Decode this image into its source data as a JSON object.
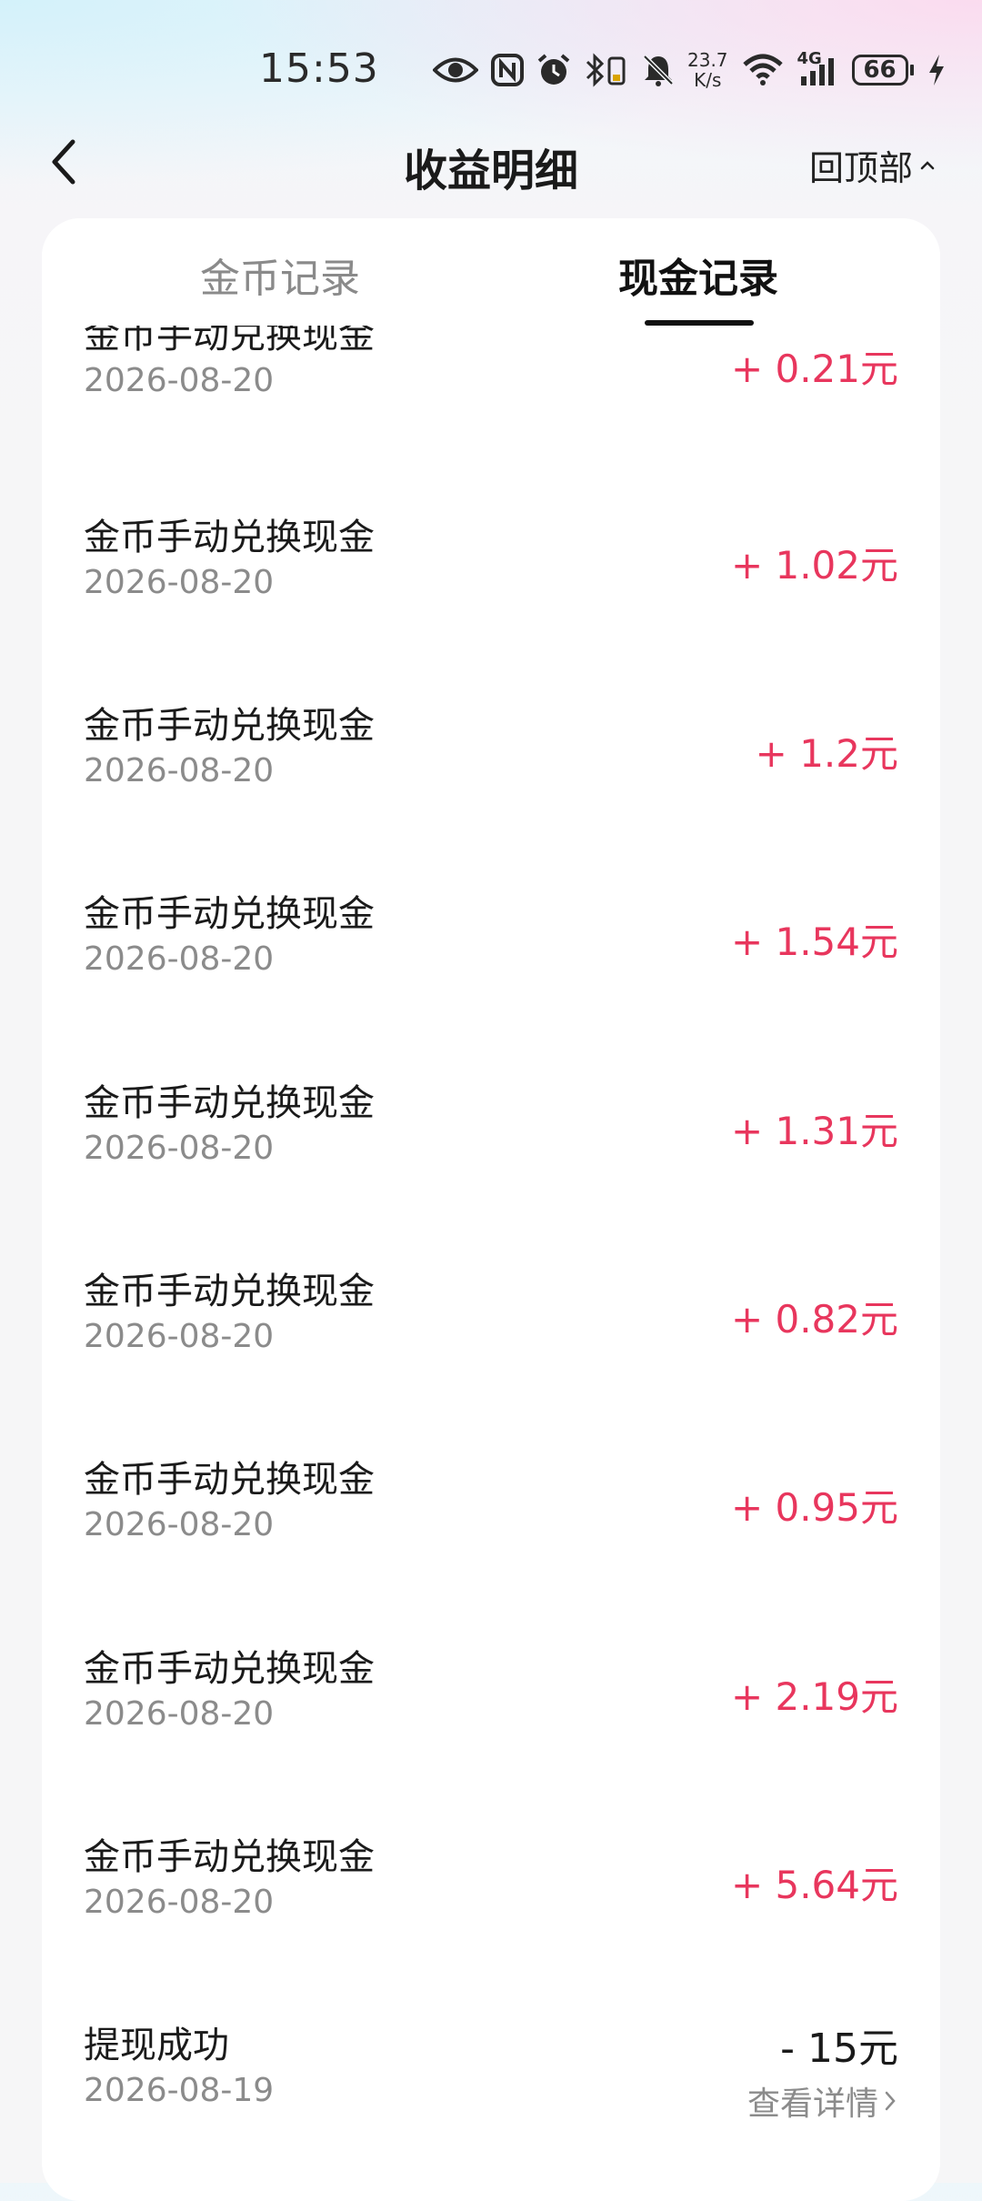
{
  "status_bar": {
    "time": "15:53",
    "net_speed_value": "23.7",
    "net_speed_unit": "K/s",
    "signal_label": "4G",
    "battery": "66",
    "icons": [
      "eye-icon",
      "nfc-icon",
      "alarm-icon",
      "bluetooth-battery-icon",
      "bell-off-icon",
      "wifi-icon",
      "cellular-signal-icon",
      "battery-icon",
      "charging-bolt-icon"
    ]
  },
  "header": {
    "title": "收益明细",
    "back_to_top": "回顶部"
  },
  "tabs": [
    {
      "label": "金币记录",
      "active": false
    },
    {
      "label": "现金记录",
      "active": true
    }
  ],
  "colors": {
    "accent_red": "#e8365d",
    "muted_gray": "#8b8b8b"
  },
  "records": [
    {
      "title": "金币手动兑换现金",
      "date": "2026-08-20",
      "amount": "+ 0.21元"
    },
    {
      "title": "金币手动兑换现金",
      "date": "2026-08-20",
      "amount": "+ 1.02元"
    },
    {
      "title": "金币手动兑换现金",
      "date": "2026-08-20",
      "amount": "+ 1.2元"
    },
    {
      "title": "金币手动兑换现金",
      "date": "2026-08-20",
      "amount": "+ 1.54元"
    },
    {
      "title": "金币手动兑换现金",
      "date": "2026-08-20",
      "amount": "+ 1.31元"
    },
    {
      "title": "金币手动兑换现金",
      "date": "2026-08-20",
      "amount": "+ 0.82元"
    },
    {
      "title": "金币手动兑换现金",
      "date": "2026-08-20",
      "amount": "+ 0.95元"
    },
    {
      "title": "金币手动兑换现金",
      "date": "2026-08-20",
      "amount": "+ 2.19元"
    },
    {
      "title": "金币手动兑换现金",
      "date": "2026-08-20",
      "amount": "+ 5.64元"
    }
  ],
  "withdrawal": {
    "title": "提现成功",
    "date": "2026-08-19",
    "amount": "- 15元",
    "detail_link": "查看详情"
  }
}
